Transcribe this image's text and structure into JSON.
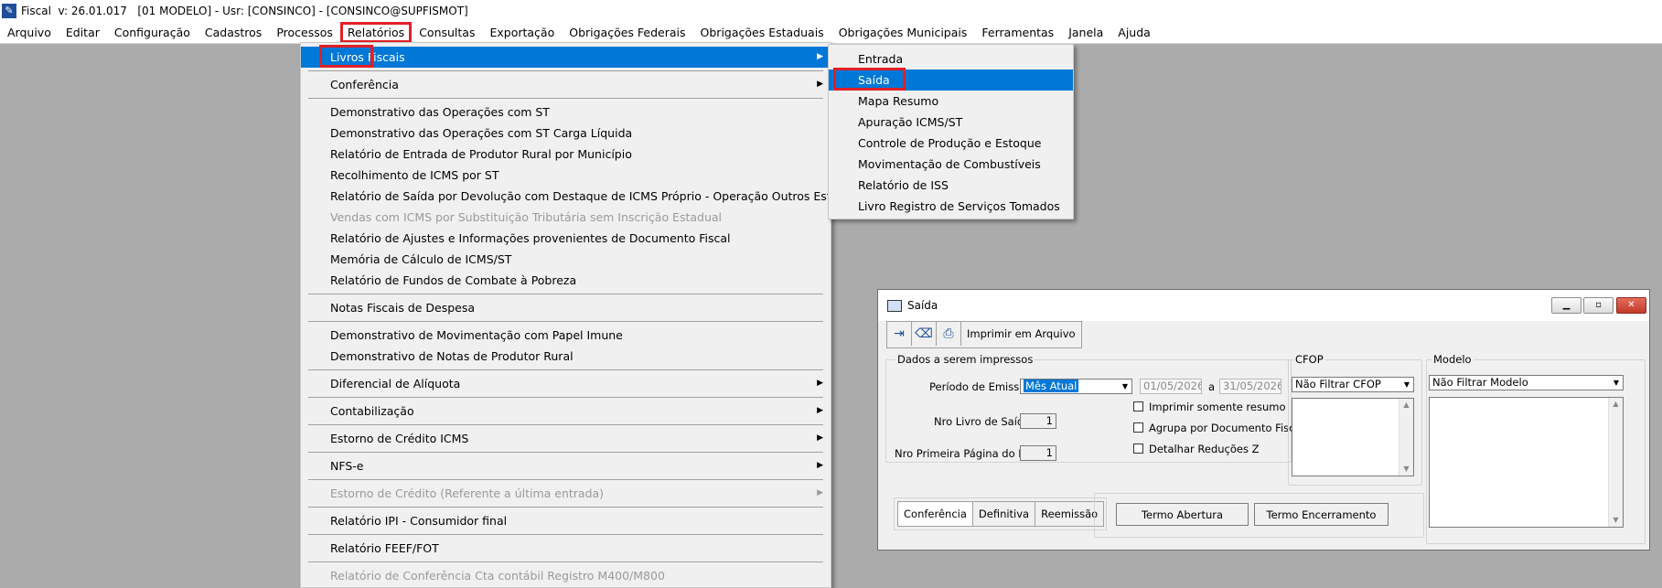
{
  "window": {
    "title": "Fiscal  v: 26.01.017   [01 MODELO] - Usr: [CONSINCO] - [CONSINCO@SUPFISMOT]"
  },
  "menubar": [
    {
      "label": "Arquivo"
    },
    {
      "label": "Editar"
    },
    {
      "label": "Configuração"
    },
    {
      "label": "Cadastros"
    },
    {
      "label": "Processos"
    },
    {
      "label": "Relatórios"
    },
    {
      "label": "Consultas"
    },
    {
      "label": "Exportação"
    },
    {
      "label": "Obrigações Federais"
    },
    {
      "label": "Obrigações Estaduais"
    },
    {
      "label": "Obrigações Municipais"
    },
    {
      "label": "Ferramentas"
    },
    {
      "label": "Janela"
    },
    {
      "label": "Ajuda"
    }
  ],
  "relatorios_menu": [
    "Livros Fiscais",
    "Conferência",
    "Demonstrativo das Operações com ST",
    "Demonstrativo das Operações com ST Carga Líquida",
    "Relatório de Entrada de Produtor Rural por Município",
    "Recolhimento de ICMS por ST",
    "Relatório de Saída por Devolução com Destaque de ICMS Próprio - Operação Outros Estados",
    "Vendas com ICMS por Substituição Tributária sem Inscrição Estadual",
    "Relatório de Ajustes e Informações provenientes de Documento Fiscal",
    "Memória de Cálculo de ICMS/ST",
    "Relatório de Fundos de Combate à Pobreza",
    "Notas Fiscais de Despesa",
    "Demonstrativo de Movimentação com Papel Imune",
    "Demonstrativo de Notas de Produtor Rural",
    "Diferencial de Alíquota",
    "Contabilização",
    "Estorno de Crédito ICMS",
    "NFS-e",
    "Estorno de Crédito (Referente a última entrada)",
    "Relatório IPI - Consumidor final",
    "Relatório FEEF/FOT",
    "Relatório de Conferência Cta contábil Registro M400/M800"
  ],
  "livros_fiscais_submenu": [
    "Entrada",
    "Saída",
    "Mapa Resumo",
    "Apuração ICMS/ST",
    "Controle de Produção e Estoque",
    "Movimentação de Combustíveis",
    "Relatório de ISS",
    "Livro Registro de Serviços Tomados"
  ],
  "dialog": {
    "title": "Saída",
    "toolbar": {
      "print_to_file": "Imprimir em Arquivo"
    },
    "group_dados": "Dados a serem impressos",
    "periodo_label": "Período de Emissão",
    "periodo_value": "Mês Atual",
    "date_from": "01/05/2026",
    "date_sep": "a",
    "date_to": "31/05/2026",
    "nro_livro_label": "Nro Livro de Saída",
    "nro_livro_value": "1",
    "nro_pagina_label": "Nro Primeira Página do Livro",
    "nro_pagina_value": "1",
    "chk_resumo": "Imprimir somente resumo",
    "chk_agrupa": "Agrupa por Documento Fiscal",
    "chk_reducoes": "Detalhar Reduções Z",
    "cfop_label": "CFOP",
    "cfop_value": "Não Filtrar CFOP",
    "modelo_label": "Modelo",
    "modelo_value": "Não Filtrar Modelo",
    "tabs": [
      "Conferência",
      "Definitiva",
      "Reemissão"
    ],
    "btn_termo_abertura": "Termo Abertura",
    "btn_termo_encerramento": "Termo Encerramento"
  }
}
